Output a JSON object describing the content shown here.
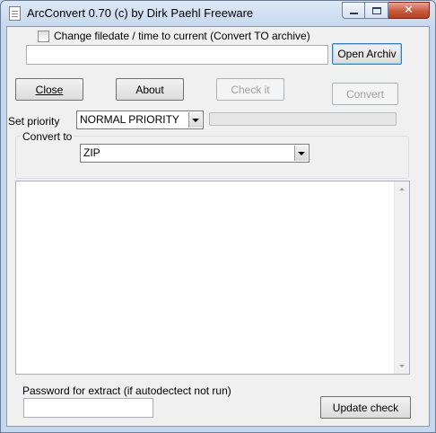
{
  "window": {
    "title": "ArcConvert 0.70 (c) by Dirk Paehl Freeware",
    "controls": {
      "minimize_icon": "minimize-icon",
      "maximize_icon": "maximize-icon",
      "close_glyph": "✕"
    }
  },
  "options": {
    "change_filedate_label": "Change filedate / time to current (Convert TO archive)",
    "change_filedate_checked": false
  },
  "archive": {
    "path_value": "",
    "open_button": "Open Archiv"
  },
  "buttons": {
    "close": "Close",
    "about": "About",
    "check_it": "Check it",
    "convert": "Convert"
  },
  "priority": {
    "label": "Set priority",
    "selected": "NORMAL PRIORITY",
    "progress": 0
  },
  "convert_to": {
    "group_label": "Convert to",
    "selected": "ZIP"
  },
  "log": {
    "content": ""
  },
  "password": {
    "label": "Password for extract (if autodectect not run)",
    "value": ""
  },
  "update_button": "Update check"
}
